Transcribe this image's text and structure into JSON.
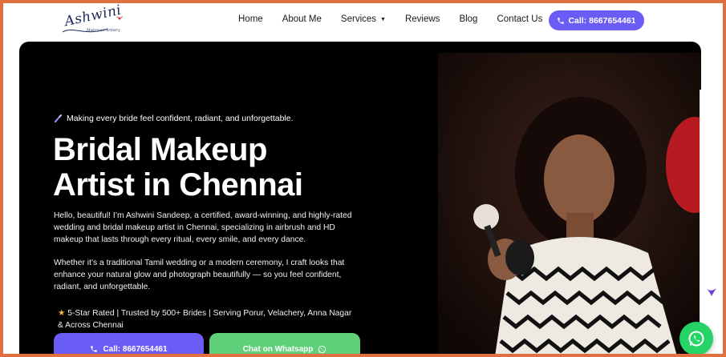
{
  "header": {
    "logo_text": "Ashwini",
    "logo_subtext": "Makeover Artistry",
    "nav": [
      {
        "label": "Home"
      },
      {
        "label": "About Me"
      },
      {
        "label": "Services",
        "has_dropdown": true
      },
      {
        "label": "Reviews"
      },
      {
        "label": "Blog"
      },
      {
        "label": "Contact Us"
      }
    ],
    "call_button": "Call: 8667654461"
  },
  "hero": {
    "tagline": "Making every bride feel confident, radiant, and unforgettable.",
    "headline_line1": "Bridal Makeup",
    "headline_line2": "Artist in Chennai",
    "paragraph1": "Hello, beautiful! I’m Ashwini Sandeep, a certified, award-winning, and highly-rated wedding and bridal makeup artist in Chennai, specializing in airbrush and HD makeup that lasts through every ritual, every smile, and every dance.",
    "paragraph2": "Whether it’s a traditional Tamil wedding or a modern ceremony, I craft looks that enhance your natural glow and photograph beautifully — so you feel confident, radiant, and unforgettable.",
    "rating": "5-Star Rated | Trusted by 500+ Brides | Serving Porur, Velachery, Anna Nagar & Across Chennai",
    "call_button": "Call: 8667654461",
    "whatsapp_button": "Chat on Whatsapp"
  },
  "colors": {
    "accent": "#6b5cf6",
    "whatsapp": "#25d366",
    "frame": "#e07040"
  },
  "icons": [
    "brush-icon",
    "phone-icon",
    "whatsapp-icon",
    "star-icon",
    "caret-down-icon"
  ]
}
